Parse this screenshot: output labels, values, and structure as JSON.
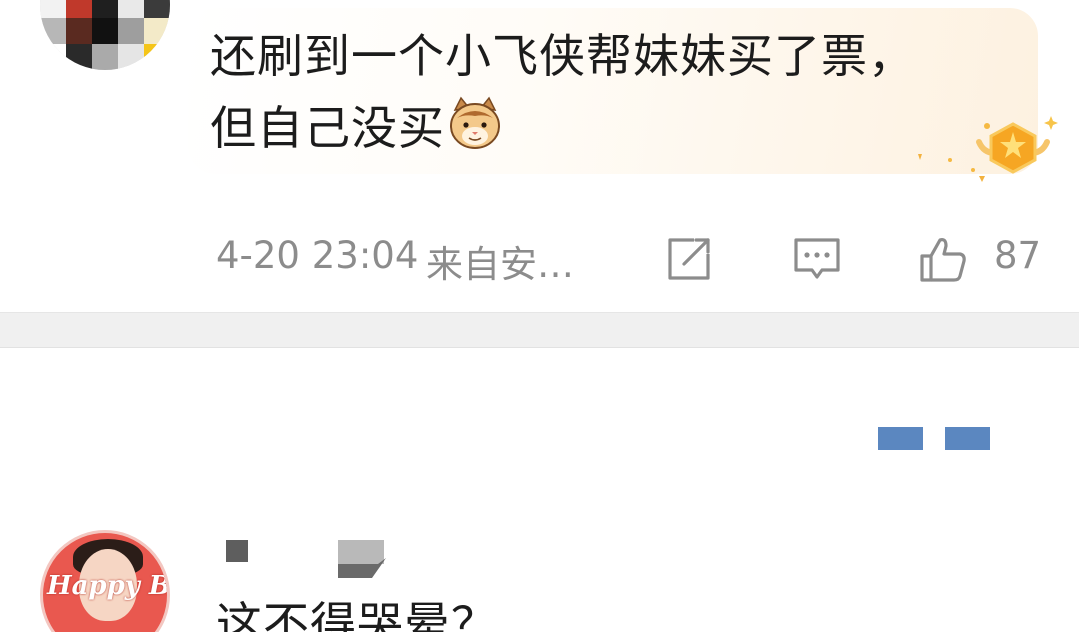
{
  "comment1": {
    "text_line1": "还刷到一个小飞侠帮妹妹买了票，",
    "text_line2": "但自己没买",
    "emoji": "cat-face-emoji",
    "time": "4-20 23:04",
    "source": "来自安…",
    "share_icon": "share-icon",
    "reply_icon": "comment-icon",
    "like_icon": "thumbs-up-icon",
    "like_count": "87"
  },
  "comment2": {
    "text": "这不得哭晕？",
    "avatar_text": "Happy Birthday"
  },
  "colors": {
    "text": "#1c1c1c",
    "meta": "#8c8c8c",
    "divider": "#f0f0f0",
    "redaction": "#5b87c0"
  }
}
